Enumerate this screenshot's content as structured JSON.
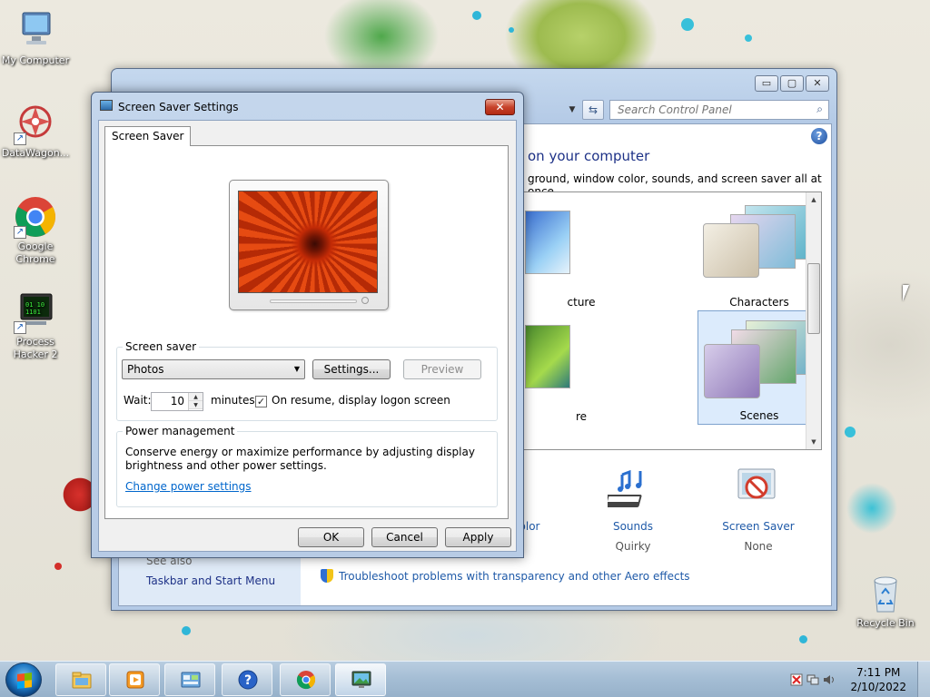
{
  "desktop": {
    "icons": [
      {
        "label": "My Computer",
        "icon": "computer-icon"
      },
      {
        "label": "DataWagon...",
        "icon": "datawagon-icon"
      },
      {
        "label": "Google Chrome",
        "icon": "chrome-icon"
      },
      {
        "label": "Process Hacker 2",
        "icon": "process-hacker-icon"
      },
      {
        "label": "Recycle Bin",
        "icon": "recycle-bin-icon"
      }
    ]
  },
  "control_panel": {
    "search_placeholder": "Search Control Panel",
    "heading": "on your computer",
    "description": "ground, window color, sounds, and screen saver all at once.",
    "themes": [
      {
        "label": "cture",
        "selected": false
      },
      {
        "label": "Characters",
        "selected": false
      },
      {
        "label": "re",
        "selected": false
      },
      {
        "label": "Scenes",
        "selected": true
      }
    ],
    "items": [
      {
        "title": "olor",
        "sub": ""
      },
      {
        "title": "Sounds",
        "sub": "Quirky"
      },
      {
        "title": "Screen Saver",
        "sub": "None"
      }
    ],
    "see_also": "See also",
    "taskbar_link": "Taskbar and Start Menu",
    "troubleshoot_link": "Troubleshoot problems with transparency and other Aero effects",
    "caption_buttons": {
      "minimize": "▭",
      "maximize": "▢",
      "close": "✕"
    }
  },
  "dialog": {
    "title": "Screen Saver Settings",
    "close_label": "✕",
    "tab": "Screen Saver",
    "screen_saver_group": "Screen saver",
    "selected_saver": "Photos",
    "settings_button": "Settings...",
    "preview_button": "Preview",
    "wait_label": "Wait:",
    "wait_value": "10",
    "minutes_label": "minutes",
    "resume_checkbox_label": "On resume, display logon screen",
    "resume_checked": true,
    "power_group": "Power management",
    "power_text_1": "Conserve energy or maximize performance by adjusting display",
    "power_text_2": "brightness and other power settings.",
    "power_link": "Change power settings",
    "ok_button": "OK",
    "cancel_button": "Cancel",
    "apply_button": "Apply"
  },
  "taskbar": {
    "buttons": [
      "explorer-icon",
      "media-player-icon",
      "control-panel-icon",
      "help-icon",
      "chrome-icon",
      "screen-saver-icon"
    ],
    "clock_time": "7:11 PM",
    "clock_date": "2/10/2022"
  },
  "colors": {
    "link": "#1f5aa8",
    "heading": "#1e3287",
    "close_red": "#c7432b",
    "selection": "#dcebfc"
  }
}
